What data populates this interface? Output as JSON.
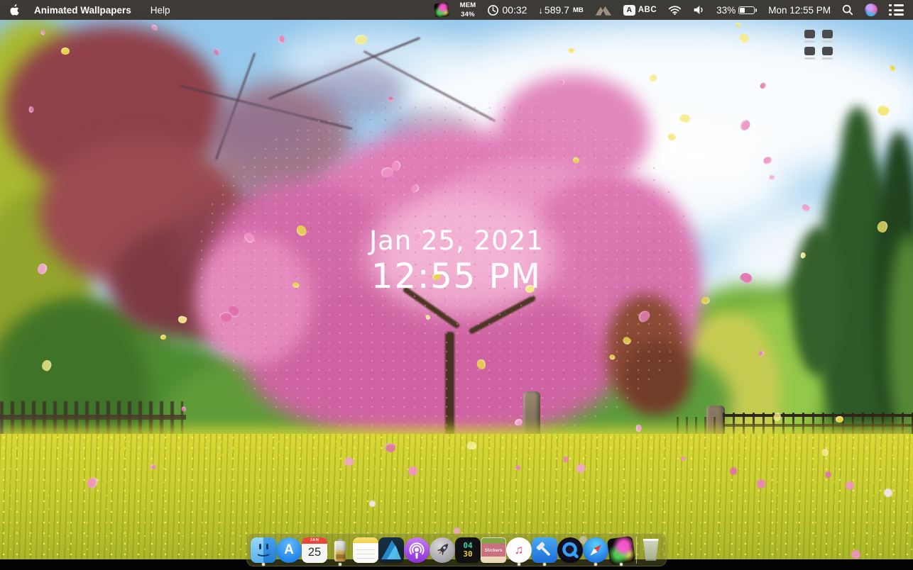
{
  "menu_bar": {
    "app_name": "Animated Wallpapers",
    "menus": [
      "Help"
    ],
    "status": {
      "memory_label": "MEM",
      "memory_value": "34%",
      "stopwatch_time": "00:32",
      "download_arrow": "↓",
      "download_value": "589.7",
      "download_unit": "MB",
      "input_badge": "A",
      "input_label": "ABC",
      "battery_percent": "33%",
      "clock": "Mon 12:55 PM"
    }
  },
  "desktop": {
    "overlay_date": "Jan 25, 2021",
    "overlay_time": "12:55 PM"
  },
  "dock": {
    "items": [
      {
        "name": "finder",
        "running": true
      },
      {
        "name": "app-store",
        "glyph": "A"
      },
      {
        "name": "calendar",
        "month": "JAN",
        "day": "25"
      },
      {
        "name": "battery-monitor",
        "running": true
      },
      {
        "name": "notes"
      },
      {
        "name": "affinity-designer"
      },
      {
        "name": "podcasts"
      },
      {
        "name": "rocket"
      },
      {
        "name": "timer",
        "top": "04",
        "bottom": "30"
      },
      {
        "name": "stickers",
        "label": "Stickers"
      },
      {
        "name": "music",
        "glyph": "♫",
        "running": true
      },
      {
        "name": "xcode",
        "running": true
      },
      {
        "name": "quicktime"
      },
      {
        "name": "safari",
        "running": true
      },
      {
        "name": "animated-wallpapers",
        "running": true
      },
      {
        "name": "trash"
      }
    ]
  },
  "colors": {
    "menu_bar_bg": "#3a3631",
    "overlay_text": "#ffffff",
    "meadow_yellow": "#c9cc2e",
    "blossom_pink": "#e07cb6",
    "petal_yellow": "#f3e468"
  }
}
